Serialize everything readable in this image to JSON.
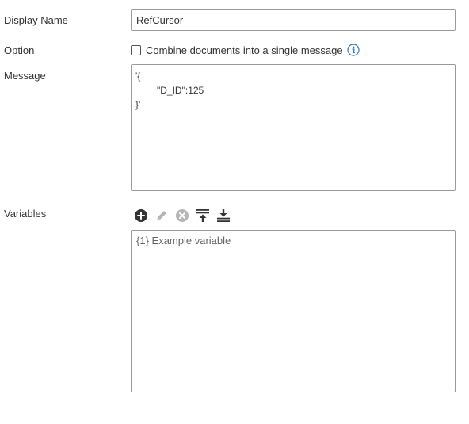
{
  "display_name": {
    "label": "Display Name",
    "value": "RefCursor"
  },
  "option": {
    "label": "Option",
    "checkbox_label": "Combine documents into a single message",
    "checked": false,
    "info_icon": "info-circle-icon"
  },
  "message": {
    "label": "Message",
    "lines": [
      "'{",
      "\"D_ID\":125",
      "}'"
    ]
  },
  "variables": {
    "label": "Variables",
    "toolbar": {
      "add_icon": "plus-circle-icon",
      "edit_icon": "pencil-icon",
      "remove_icon": "x-circle-icon",
      "move_top_icon": "move-to-top-icon",
      "move_bottom_icon": "move-to-bottom-icon"
    },
    "items": [
      "{1} Example variable"
    ]
  },
  "colors": {
    "border": "#9a9a9a",
    "text": "#333333",
    "info_blue": "#2e7bbf",
    "icon_dark": "#333333",
    "icon_disabled": "#b5b5b5"
  }
}
